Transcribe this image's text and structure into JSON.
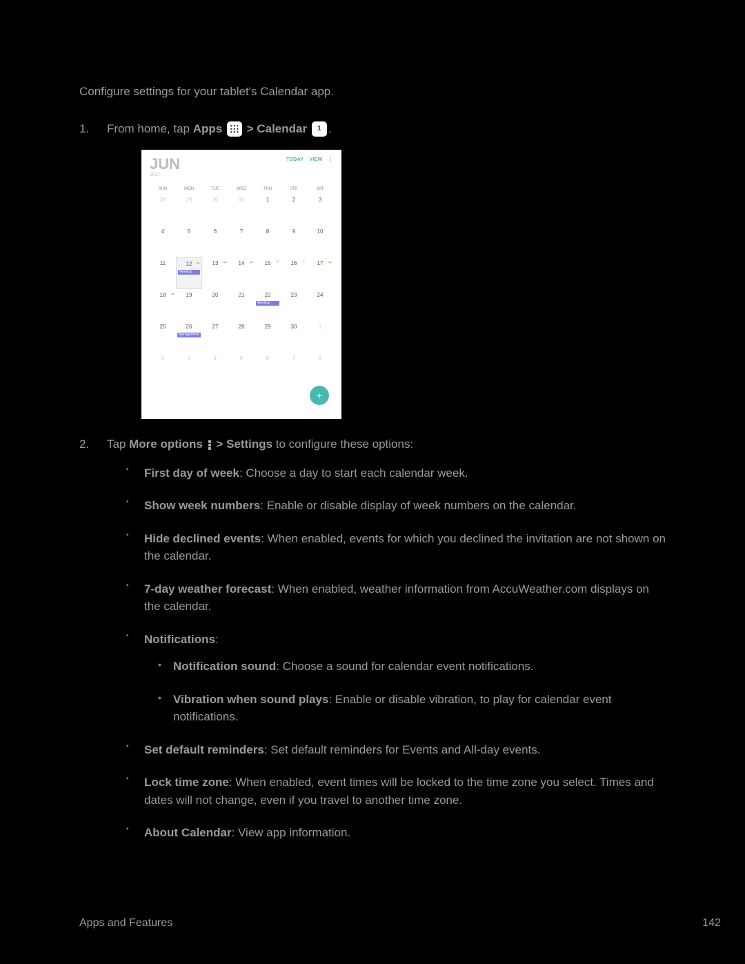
{
  "intro": "Configure settings for your tablet's Calendar app.",
  "steps": {
    "one": {
      "num": "1.",
      "prefix": "From home, tap ",
      "apps": "Apps",
      "sep": " > ",
      "calendar": "Calendar",
      "period": "."
    },
    "two": {
      "num": "2.",
      "prefix": "Tap ",
      "more": "More options",
      "sep": " > ",
      "settings": "Settings",
      "suffix": " to configure these options:"
    }
  },
  "cal": {
    "month": "JUN",
    "year": "2017",
    "today": "TODAY",
    "view": "VIEW",
    "dow": [
      "SUN",
      "MON",
      "TUE",
      "WED",
      "THU",
      "FRI",
      "SAT"
    ],
    "events": {
      "meeting": "Meeting",
      "management": "Management"
    },
    "fab": "+"
  },
  "options": [
    {
      "bold": "First day of week",
      "text": ": Choose a day to start each calendar week."
    },
    {
      "bold": "Show week numbers",
      "text": ": Enable or disable display of week numbers on the calendar."
    },
    {
      "bold": "Hide declined events",
      "text": ": When enabled, events for which you declined the invitation are not shown on the calendar."
    },
    {
      "bold": "7-day weather forecast",
      "text": ": When enabled, weather information from AccuWeather.com displays on the calendar."
    },
    {
      "bold": "Notifications",
      "text": ":",
      "children": [
        {
          "bold": "Notification sound",
          "text": ": Choose a sound for calendar event notifications."
        },
        {
          "bold": "Vibration when sound plays",
          "text": ": Enable or disable vibration, to play for calendar event notifications."
        }
      ]
    },
    {
      "bold": "Set default reminders",
      "text": ": Set default reminders for Events and All-day events."
    },
    {
      "bold": "Lock time zone",
      "text": ": When enabled, event times will be locked to the time zone you select. Times and dates will not change, even if you travel to another time zone."
    },
    {
      "bold": "About Calendar",
      "text": ": View app information."
    }
  ],
  "footer": {
    "section": "Apps and Features",
    "page": "142"
  }
}
